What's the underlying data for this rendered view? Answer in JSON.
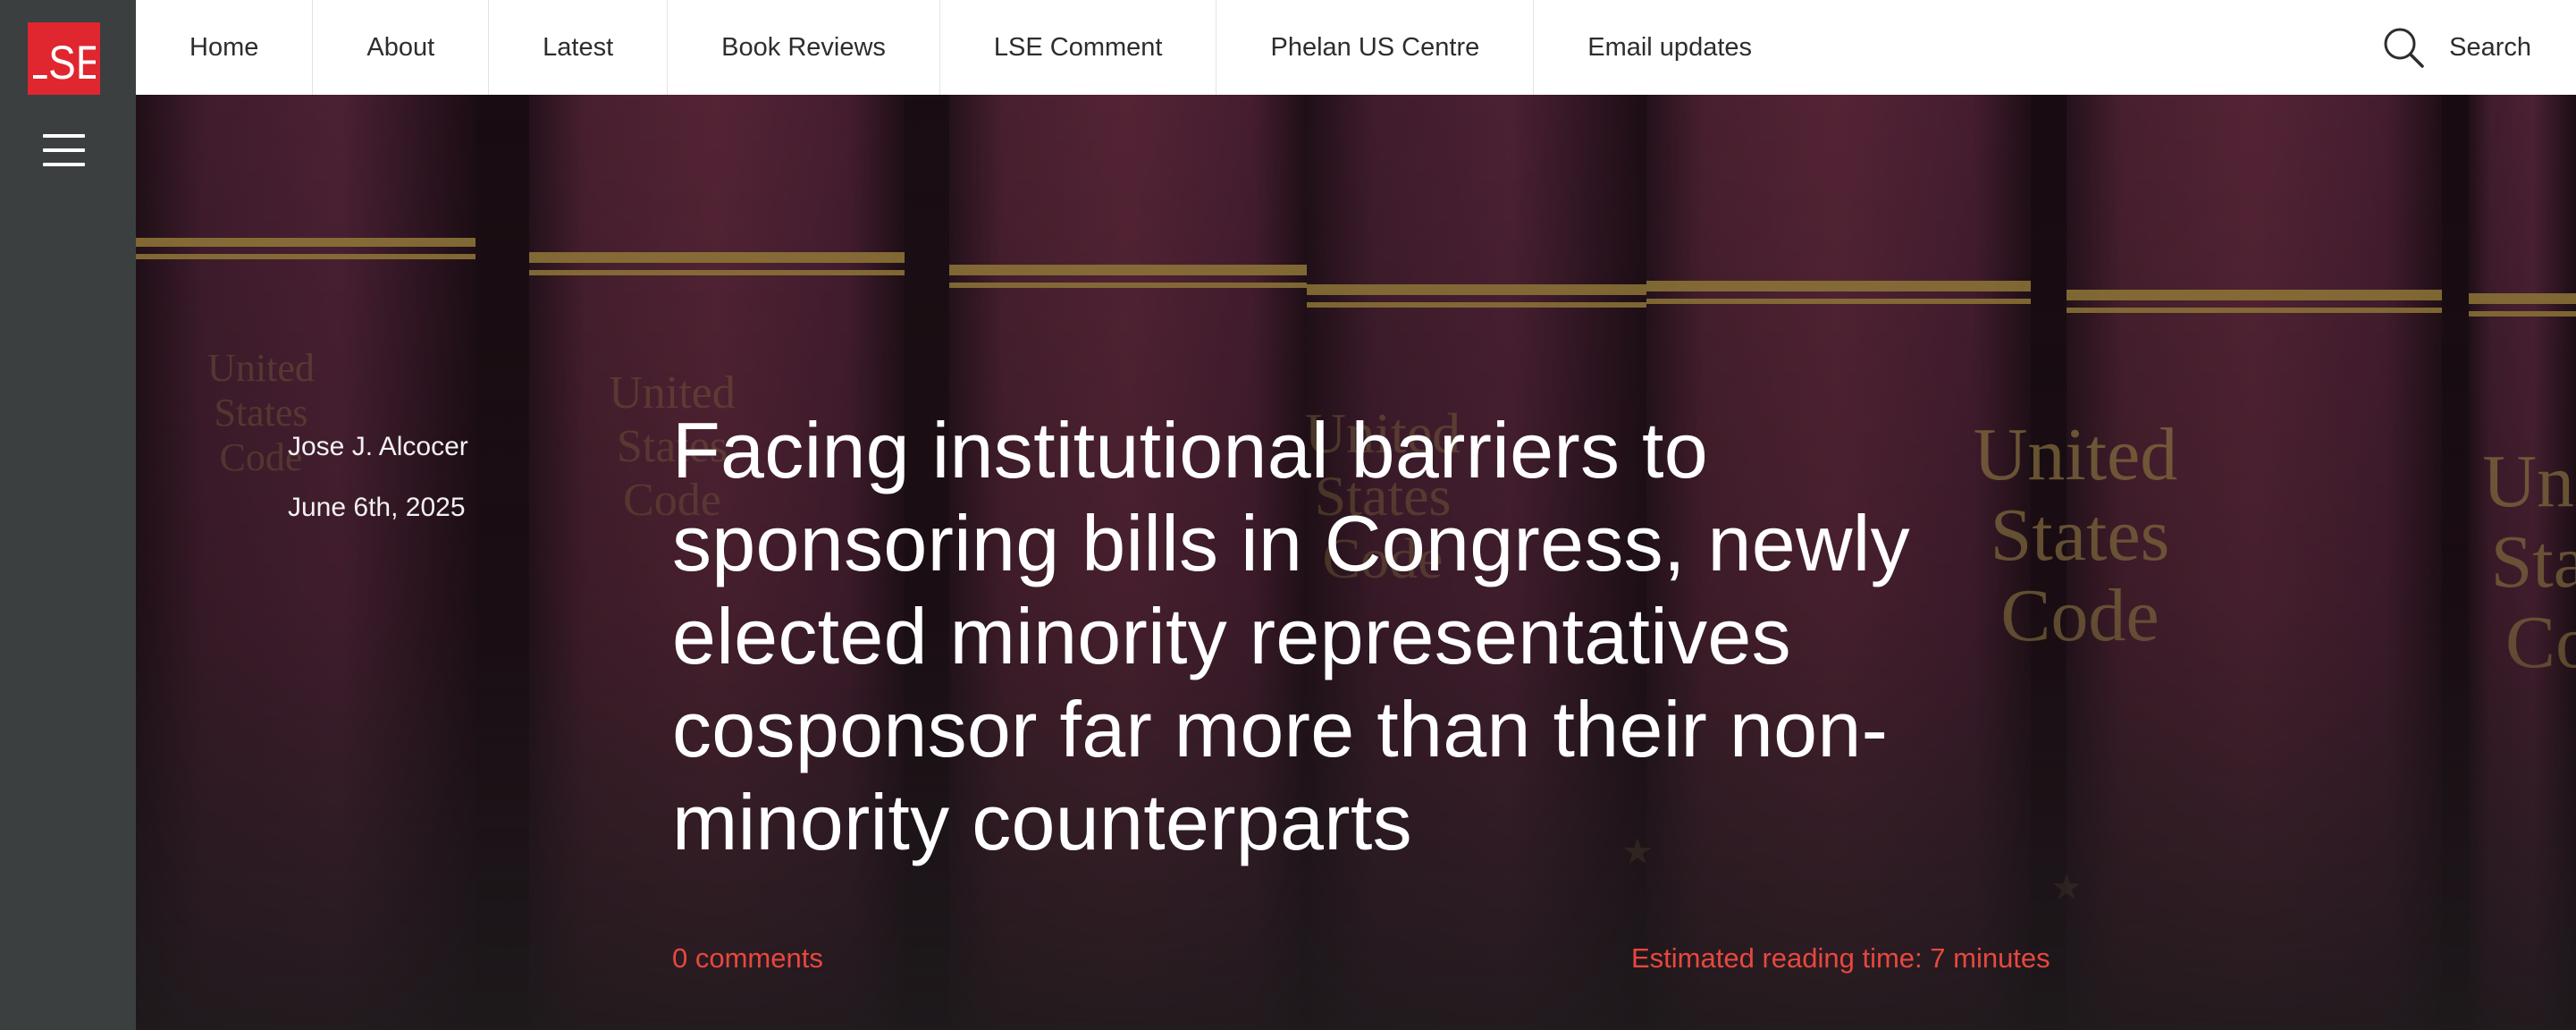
{
  "logo": {
    "text": "LSE",
    "color": "#e0262f"
  },
  "nav": {
    "items": [
      {
        "label": "Home"
      },
      {
        "label": "About"
      },
      {
        "label": "Latest"
      },
      {
        "label": "Book Reviews"
      },
      {
        "label": "LSE Comment"
      },
      {
        "label": "Phelan US Centre"
      },
      {
        "label": "Email updates"
      }
    ],
    "search_label": "Search"
  },
  "article": {
    "author": "Jose J. Alcocer",
    "date": "June 6th, 2025",
    "title": "Facing institutional barriers to sponsoring bills in Congress, newly elected minority representatives cosponsor far more than their non-minority counterparts",
    "comments": "0 comments",
    "reading_time": "Estimated reading time: 7 minutes",
    "accent_color": "#e8473f"
  },
  "hero_image": {
    "book_spine_text": [
      "United",
      "States",
      "Code"
    ]
  }
}
